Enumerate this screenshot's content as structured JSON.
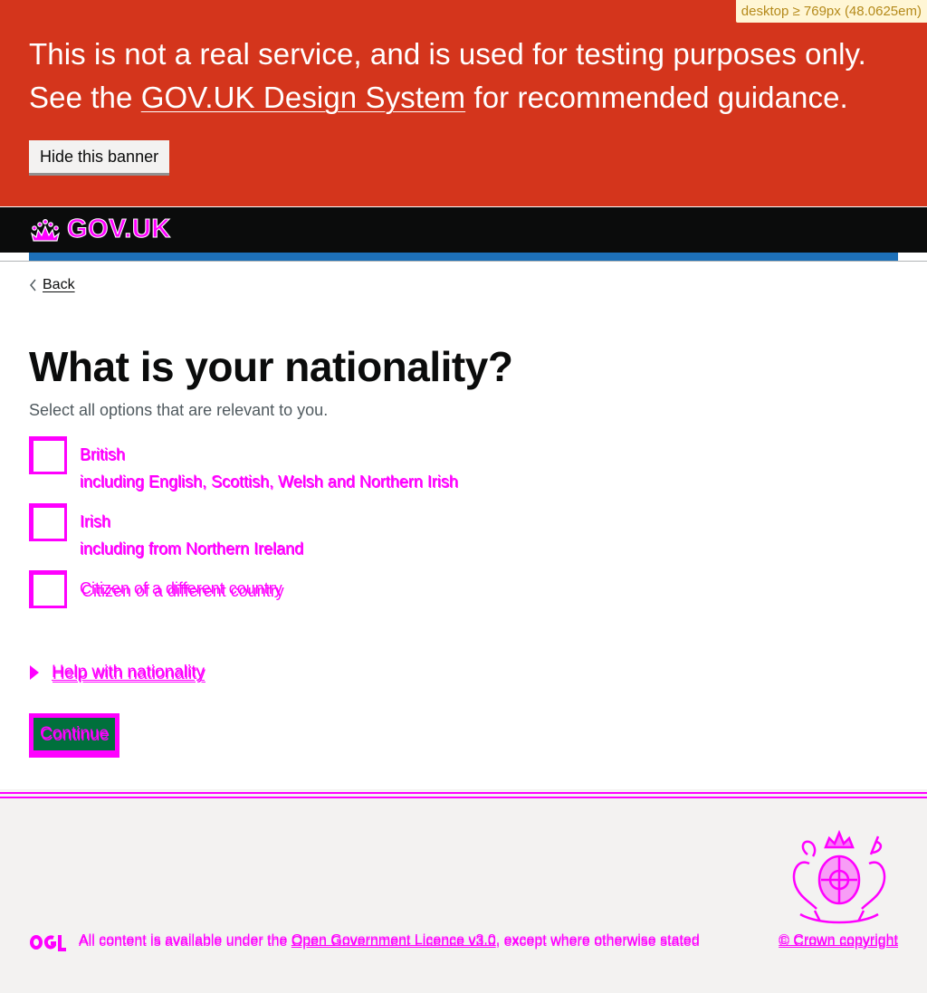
{
  "breakpoint_badge": "desktop ≥ 769px (48.0625em)",
  "banner": {
    "line1": "This is not a real service, and is used for testing purposes only.",
    "line2_prefix": "See the ",
    "link_text": "GOV.UK Design System",
    "line2_suffix": " for recommended guidance.",
    "hide_button": "Hide this banner"
  },
  "header": {
    "logo_text": "GOV.UK"
  },
  "nav": {
    "back_label": "Back"
  },
  "question": {
    "title": "What is your nationality?",
    "hint": "Select all options that are relevant to you.",
    "options": [
      {
        "label": "British",
        "hint": "including English, Scottish, Welsh and Northern Irish"
      },
      {
        "label": "Irish",
        "hint": "including from Northern Ireland"
      },
      {
        "label": "Citizen of a different country",
        "hint": ""
      }
    ]
  },
  "details": {
    "summary": "Help with nationality"
  },
  "continue_button": "Continue",
  "footer": {
    "licence_prefix": "All content is available under the ",
    "licence_link": "Open Government Licence v3.0",
    "licence_suffix": ", except where otherwise stated",
    "copyright": "© Crown copyright"
  },
  "colors": {
    "banner_red": "#d4351c",
    "header_black": "#0b0c0c",
    "brand_blue": "#1d70b8",
    "button_green": "#00703c",
    "focus_magenta": "#ff00ff",
    "footer_grey": "#f3f2f1"
  }
}
